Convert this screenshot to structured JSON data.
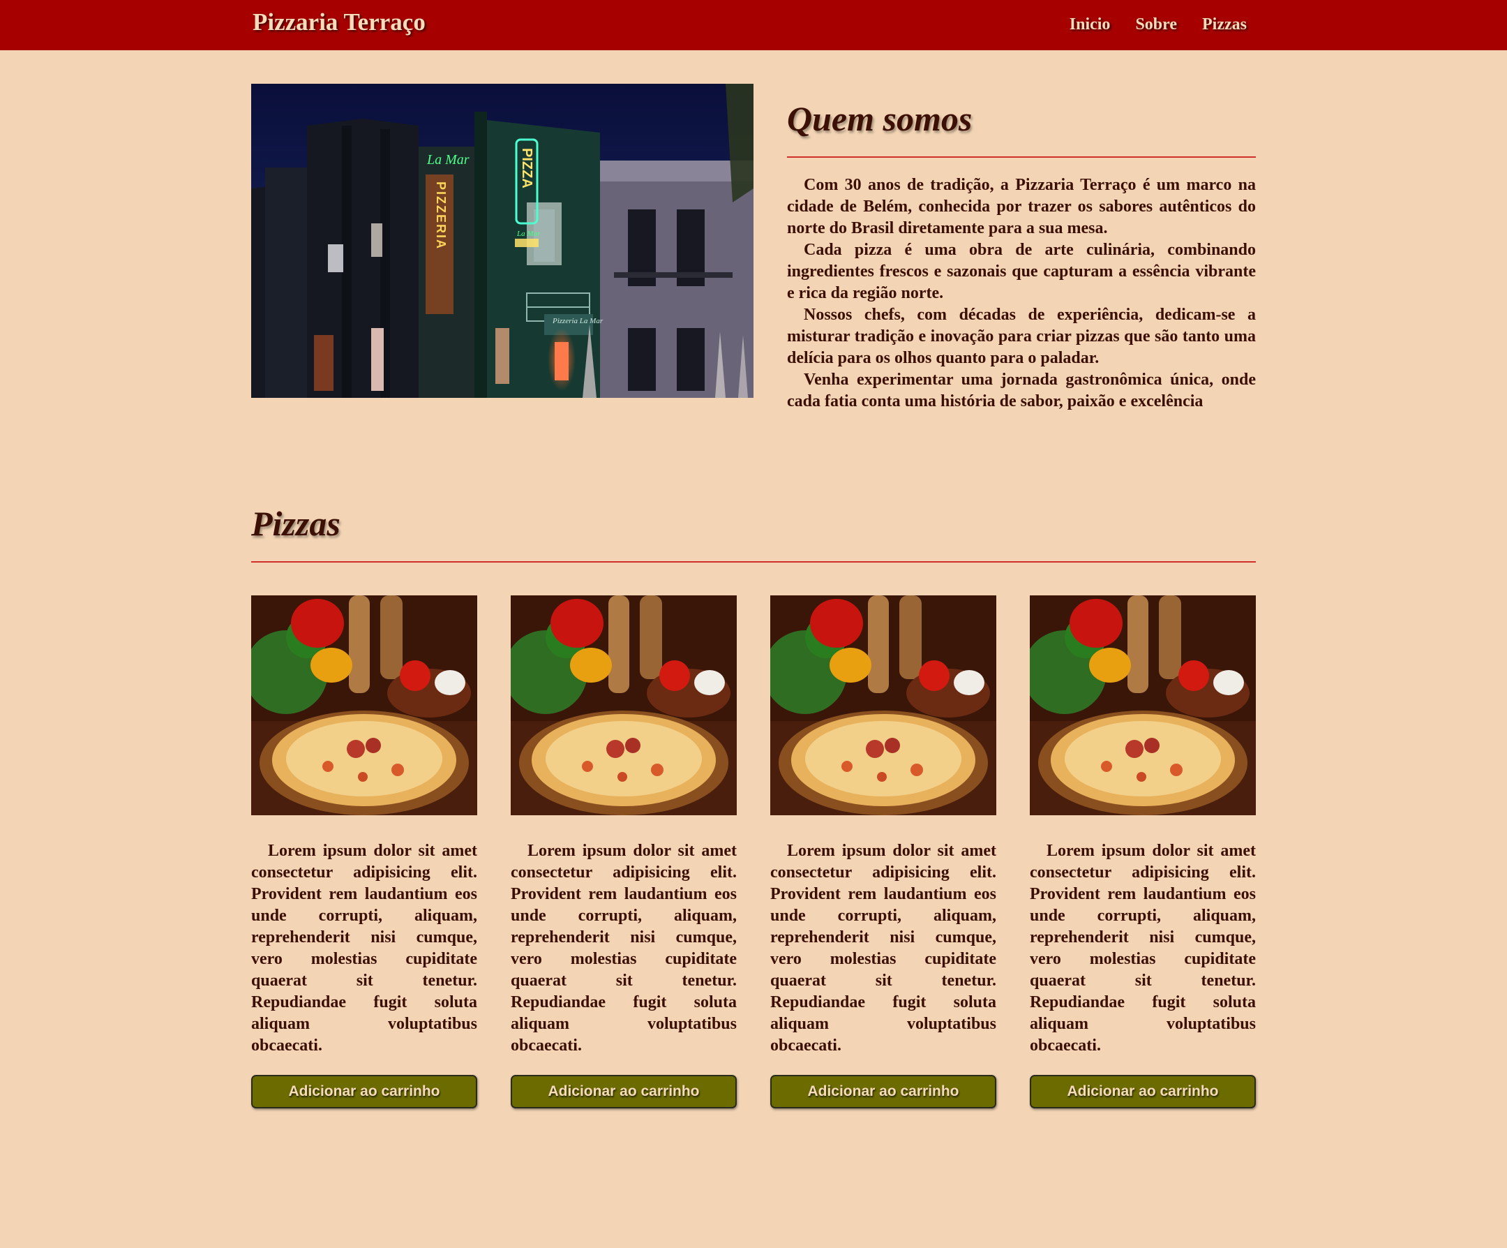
{
  "header": {
    "brand": "Pizzaria Terraço",
    "nav": [
      "Inicio",
      "Sobre",
      "Pizzas"
    ]
  },
  "about": {
    "title": "Quem somos",
    "paragraphs": [
      "Com 30 anos de tradição, a Pizzaria Terraço é um marco na cidade de Belém, conhecida por trazer os sabores autênticos do norte do Brasil diretamente para a sua mesa.",
      "Cada pizza é uma obra de arte culinária, combinando ingredientes frescos e sazonais que capturam a essência vibrante e rica da região norte.",
      "Nossos chefs, com décadas de experiência, dedicam-se a misturar tradição e inovação para criar pizzas que são tanto uma delícia para os olhos quanto para o paladar.",
      "Venha experimentar uma jornada gastronômica única, onde cada fatia conta uma história de sabor, paixão e excelência"
    ],
    "photo_signs": {
      "left_brand": "La Mar",
      "left_word": "PIZZERIA",
      "right_word": "PIZZA",
      "right_brand": "La Mar",
      "door_sign": "Pizzeria La Mar"
    }
  },
  "pizzas": {
    "title": "Pizzas",
    "cards": [
      {
        "description": "Lorem ipsum dolor sit amet consectetur adipisicing elit. Provident rem laudantium eos unde corrupti, aliquam, reprehenderit nisi cumque, vero molestias cupiditate quaerat sit tenetur. Repudiandae fugit soluta aliquam voluptatibus obcaecati.",
        "button": "Adicionar ao carrinho"
      },
      {
        "description": "Lorem ipsum dolor sit amet consectetur adipisicing elit. Provident rem laudantium eos unde corrupti, aliquam, reprehenderit nisi cumque, vero molestias cupiditate quaerat sit tenetur. Repudiandae fugit soluta aliquam voluptatibus obcaecati.",
        "button": "Adicionar ao carrinho"
      },
      {
        "description": "Lorem ipsum dolor sit amet consectetur adipisicing elit. Provident rem laudantium eos unde corrupti, aliquam, reprehenderit nisi cumque, vero molestias cupiditate quaerat sit tenetur. Repudiandae fugit soluta aliquam voluptatibus obcaecati.",
        "button": "Adicionar ao carrinho"
      },
      {
        "description": "Lorem ipsum dolor sit amet consectetur adipisicing elit. Provident rem laudantium eos unde corrupti, aliquam, reprehenderit nisi cumque, vero molestias cupiditate quaerat sit tenetur. Repudiandae fugit soluta aliquam voluptatibus obcaecati.",
        "button": "Adicionar ao carrinho"
      }
    ]
  },
  "colors": {
    "header_bg": "#a60000",
    "page_bg": "#f3d5b5",
    "rule": "#d0302a",
    "button_bg": "#6b6b00",
    "text": "#3b0f04"
  }
}
